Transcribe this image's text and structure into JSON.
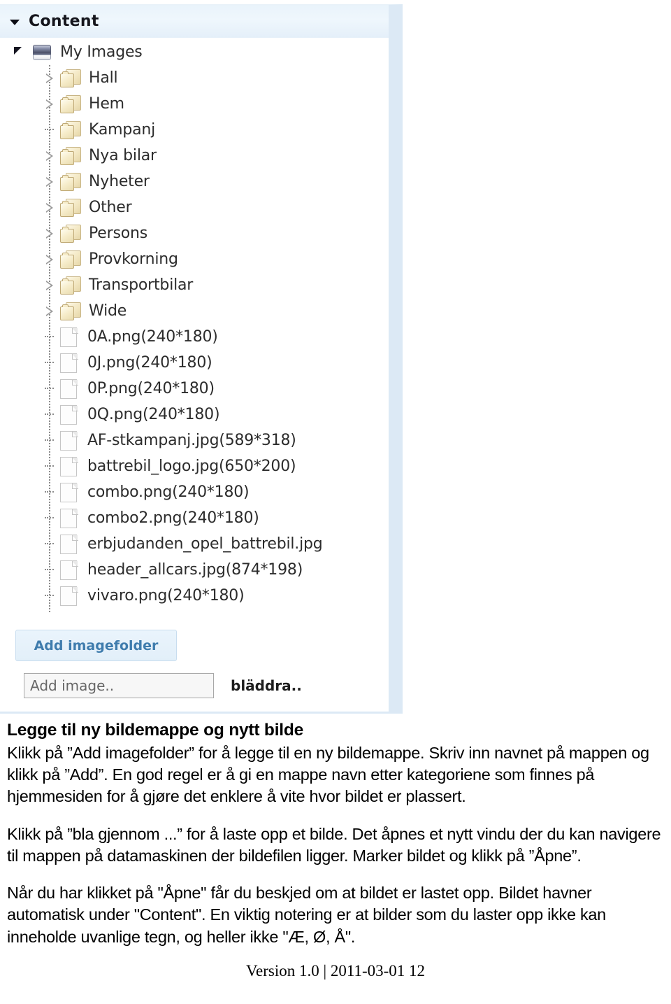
{
  "panel": {
    "header": {
      "title": "Content",
      "collapse_icon": "triangle-down-icon"
    },
    "tree": {
      "root": {
        "label": "My Images",
        "icon": "drive-icon",
        "expanded": true,
        "twisty_icon": "triangle-filled-icon"
      },
      "folders": [
        {
          "label": "Hall",
          "icon": "folder-icon",
          "twisty": "triangle-hollow-icon"
        },
        {
          "label": "Hem",
          "icon": "folder-icon",
          "twisty": "triangle-hollow-icon"
        },
        {
          "label": "Kampanj",
          "icon": "folder-icon",
          "twisty": "dotted-dash"
        },
        {
          "label": "Nya bilar",
          "icon": "folder-icon",
          "twisty": "triangle-hollow-icon"
        },
        {
          "label": "Nyheter",
          "icon": "folder-icon",
          "twisty": "triangle-hollow-icon"
        },
        {
          "label": "Other",
          "icon": "folder-icon",
          "twisty": "triangle-hollow-icon"
        },
        {
          "label": "Persons",
          "icon": "folder-icon",
          "twisty": "triangle-hollow-icon"
        },
        {
          "label": "Provkorning",
          "icon": "folder-icon",
          "twisty": "triangle-hollow-icon"
        },
        {
          "label": "Transportbilar",
          "icon": "folder-icon",
          "twisty": "triangle-hollow-icon"
        },
        {
          "label": "Wide",
          "icon": "folder-icon",
          "twisty": "triangle-hollow-icon"
        }
      ],
      "files": [
        {
          "label": "0A.png(240*180)",
          "icon": "file-icon"
        },
        {
          "label": "0J.png(240*180)",
          "icon": "file-icon"
        },
        {
          "label": "0P.png(240*180)",
          "icon": "file-icon"
        },
        {
          "label": "0Q.png(240*180)",
          "icon": "file-icon"
        },
        {
          "label": "AF-stkampanj.jpg(589*318)",
          "icon": "file-icon"
        },
        {
          "label": "battrebil_logo.jpg(650*200)",
          "icon": "file-icon"
        },
        {
          "label": "combo.png(240*180)",
          "icon": "file-icon"
        },
        {
          "label": "combo2.png(240*180)",
          "icon": "file-icon"
        },
        {
          "label": "erbjudanden_opel_battrebil.jpg",
          "icon": "file-icon"
        },
        {
          "label": "header_allcars.jpg(874*198)",
          "icon": "file-icon"
        },
        {
          "label": "vivaro.png(240*180)",
          "icon": "file-icon"
        }
      ]
    },
    "actions": {
      "add_imagefolder_label": "Add imagefolder",
      "add_image_value": "Add image..",
      "browse_label": "bläddra.."
    },
    "colors": {
      "header_bg": "#e9f3fb",
      "panel_border": "#dce9f5",
      "button_text": "#3f7cad",
      "button_bg": "#e5f0fa",
      "folder_fill": "#f6ecca",
      "drive_fill": "#4b5068"
    }
  },
  "document": {
    "heading": "Legge til ny bildemappe og nytt bilde",
    "paragraph_1": "Klikk på ”Add imagefolder” for å legge til en ny bildemappe. Skriv inn navnet på mappen og klikk på ”Add”. En god regel er å gi en mappe navn etter kategoriene som finnes på hjemmesiden for å gjøre det enklere å vite hvor bildet er plassert.",
    "paragraph_2": "Klikk på ”bla gjennom ...” for å laste opp et bilde. Det åpnes et nytt vindu der du kan navigere til mappen på datamaskinen der bildefilen ligger. Marker bildet og klikk på ”Åpne”.",
    "paragraph_3": "Når du har klikket på \"Åpne\" får du beskjed om at bildet er lastet opp. Bildet havner automatisk under \"Content\". En viktig notering er at bilder som du laster opp ikke kan inneholde uvanlige tegn, og heller ikke \"Æ, Ø, Å\".",
    "footer": "Version 1.0 | 2011-03-01 12"
  }
}
